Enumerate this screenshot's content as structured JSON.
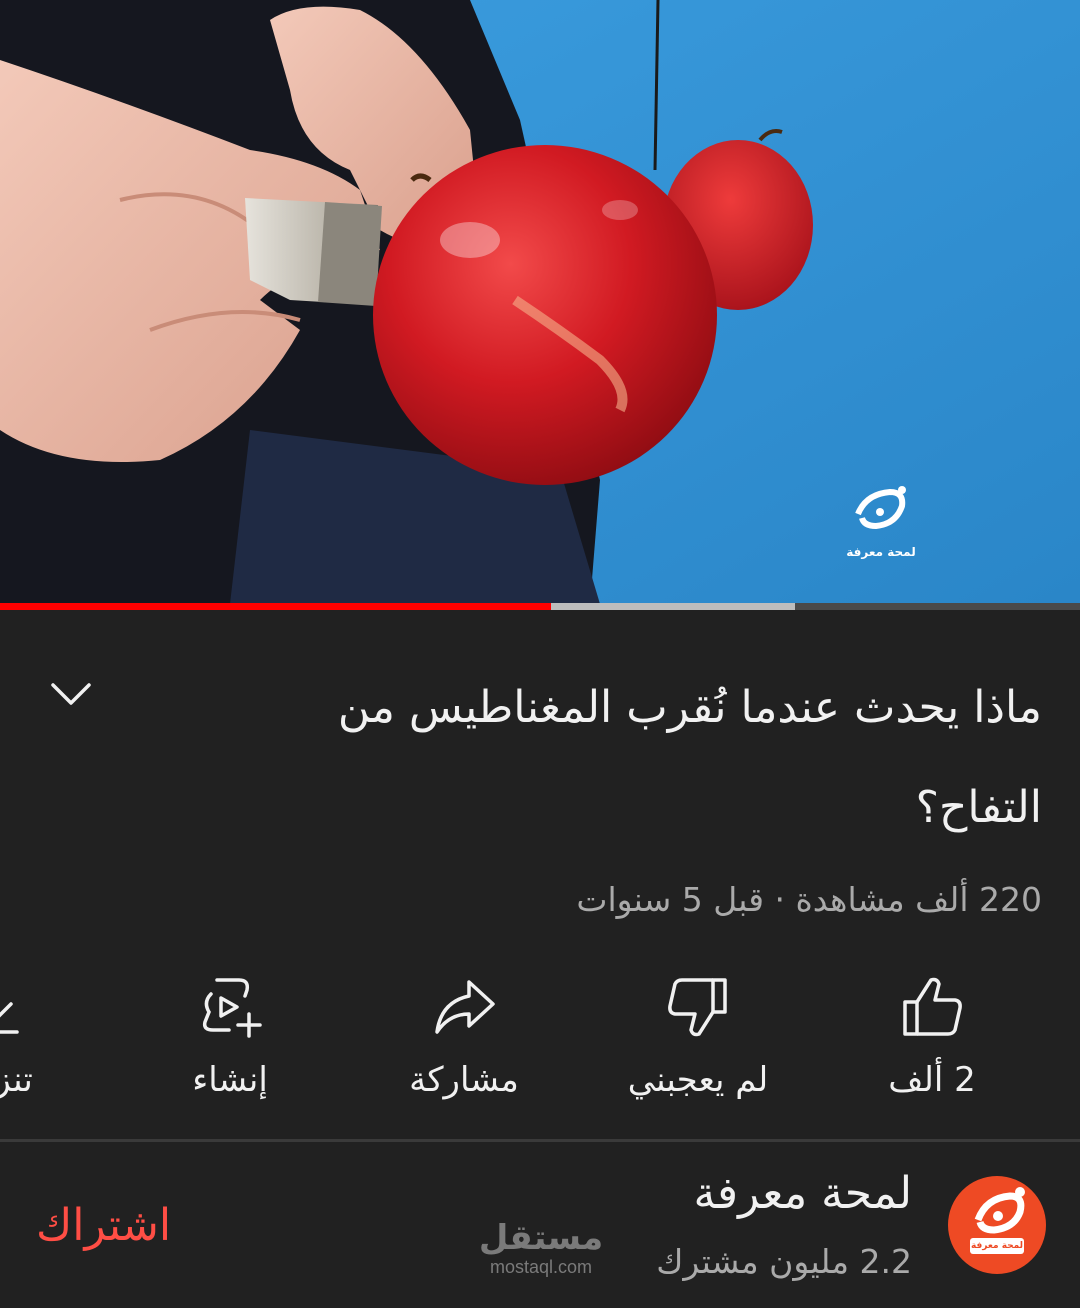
{
  "player": {
    "played_fraction": 0.51,
    "buffered_fraction": 0.736,
    "overlay_logo_text": "لمحة معرفة",
    "colors": {
      "played": "#ff0000",
      "buffered": "#bdbdbd",
      "background": "#2f8fd1"
    }
  },
  "video": {
    "title": "ماذا يحدث عندما نُقرب المغناطيس من التفاح؟",
    "meta": "220 ألف مشاهدة · قبل 5 سنوات",
    "expand_icon": "chevron-down-icon"
  },
  "actions": {
    "like": {
      "label": "2 ألف",
      "icon": "thumbs-up-icon"
    },
    "dislike": {
      "label": "لم يعجبني",
      "icon": "thumbs-down-icon"
    },
    "share": {
      "label": "مشاركة",
      "icon": "share-arrow-icon"
    },
    "create": {
      "label": "إنشاء",
      "icon": "create-remix-icon"
    },
    "download": {
      "label": "تنزيل",
      "icon": "download-icon"
    }
  },
  "channel": {
    "name": "لمحة معرفة",
    "subscribers": "2.2 مليون مشترك",
    "avatar_text": "لمحة معرفة",
    "subscribe_label": "اشتراك",
    "subscribe_color": "#ff4e45"
  },
  "watermark": {
    "arabic": "مستقل",
    "latin": "mostaql.com"
  }
}
